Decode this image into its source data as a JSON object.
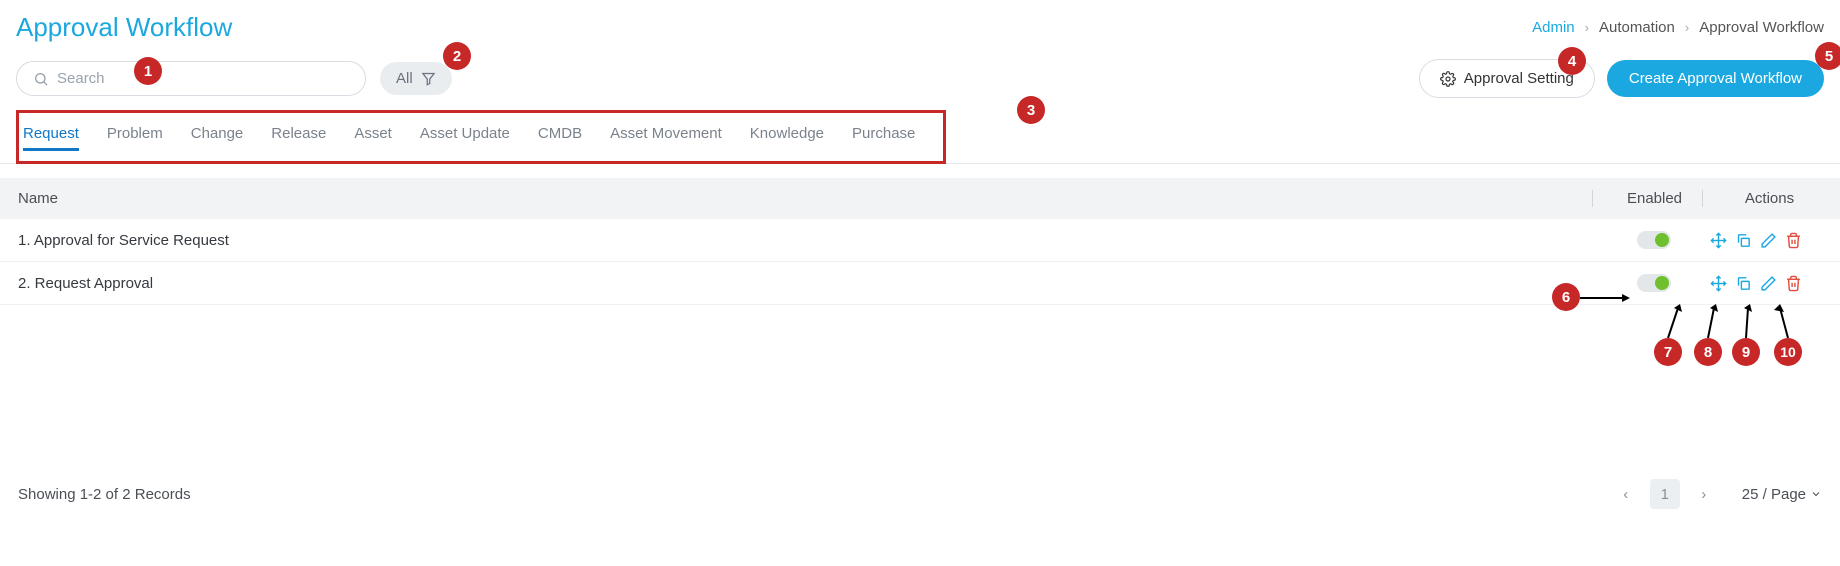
{
  "header": {
    "title": "Approval Workflow",
    "breadcrumb": {
      "item1": "Admin",
      "item2": "Automation",
      "item3": "Approval Workflow"
    }
  },
  "toolbar": {
    "search_placeholder": "Search",
    "filter_label": "All",
    "approval_setting_label": "Approval Setting",
    "create_label": "Create Approval Workflow"
  },
  "tabs": {
    "items": [
      {
        "label": "Request",
        "active": true
      },
      {
        "label": "Problem"
      },
      {
        "label": "Change"
      },
      {
        "label": "Release"
      },
      {
        "label": "Asset"
      },
      {
        "label": "Asset Update"
      },
      {
        "label": "CMDB"
      },
      {
        "label": "Asset Movement"
      },
      {
        "label": "Knowledge"
      },
      {
        "label": "Purchase"
      }
    ]
  },
  "table": {
    "col_name": "Name",
    "col_enabled": "Enabled",
    "col_actions": "Actions",
    "rows": [
      {
        "name": "1. Approval for Service Request"
      },
      {
        "name": "2. Request Approval"
      }
    ]
  },
  "footer": {
    "summary": "Showing 1-2 of 2 Records",
    "page": "1",
    "per_page": "25 / Page"
  },
  "badges": {
    "b1": "1",
    "b2": "2",
    "b3": "3",
    "b4": "4",
    "b5": "5",
    "b6": "6",
    "b7": "7",
    "b8": "8",
    "b9": "9",
    "b10": "10"
  }
}
